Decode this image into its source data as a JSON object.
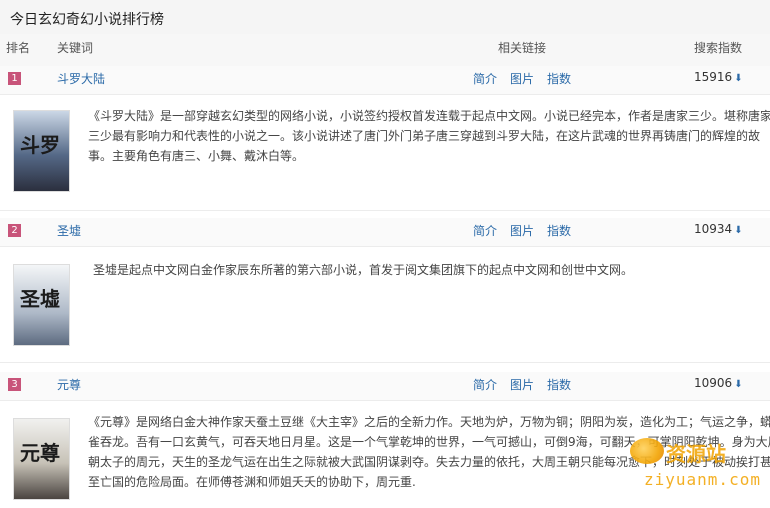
{
  "page": {
    "title": "今日玄幻奇幻小说排行榜"
  },
  "columns": {
    "rank": "排名",
    "keyword": "关键词",
    "links": "相关链接",
    "index": "搜索指数"
  },
  "link_labels": {
    "intro": "简介",
    "image": "图片",
    "index": "指数"
  },
  "colors": {
    "rank_badge": "#c8547a",
    "link": "#2b6aa8",
    "watermark": "#f2a300"
  },
  "rows": [
    {
      "rank": "1",
      "keyword": "斗罗大陆",
      "search_index": "15916",
      "trend_icon": "down-arrow-icon",
      "cover_text": "斗罗",
      "description_lines": [
        "《斗罗大陆》是一部穿越玄幻类型的网络小说，小说签约授权首发连载于起点中文网。小说已经完本，作者是唐家三少。堪称唐家",
        "三少最有影响力和代表性的小说之一。该小说讲述了唐门外门弟子唐三穿越到斗罗大陆，在这片武魂的世界再铸唐门的辉煌的故",
        "事。主要角色有唐三、小舞、戴沐白等。"
      ]
    },
    {
      "rank": "2",
      "keyword": "圣墟",
      "search_index": "10934",
      "trend_icon": "down-arrow-icon",
      "cover_text": "圣墟",
      "description_lines": [
        "圣墟是起点中文网白金作家辰东所著的第六部小说，首发于阅文集团旗下的起点中文网和创世中文网。"
      ]
    },
    {
      "rank": "3",
      "keyword": "元尊",
      "search_index": "10906",
      "trend_icon": "down-arrow-icon",
      "cover_text": "元尊",
      "description_lines": [
        "《元尊》是网络白金大神作家天蚕土豆继《大主宰》之后的全新力作。天地为炉，万物为铜；阴阳为炭，造化为工；气运之争，蟒",
        "雀吞龙。吾有一口玄黄气，可吞天地日月星。这是一个气掌乾坤的世界，一气可撼山，可倒9海，可翻天，可掌阴阳乾坤。身为大周王",
        "朝太子的周元，天生的圣龙气运在出生之际就被大武国阴谋剥夺。失去力量的依托，大周王朝只能每况愈下，时刻处于被动挨打甚",
        "至亡国的危险局面。在师傅苍渊和师姐夭夭的协助下，周元重."
      ]
    }
  ],
  "watermark": {
    "cn": "资源站",
    "en": "ziyuanm.com"
  }
}
